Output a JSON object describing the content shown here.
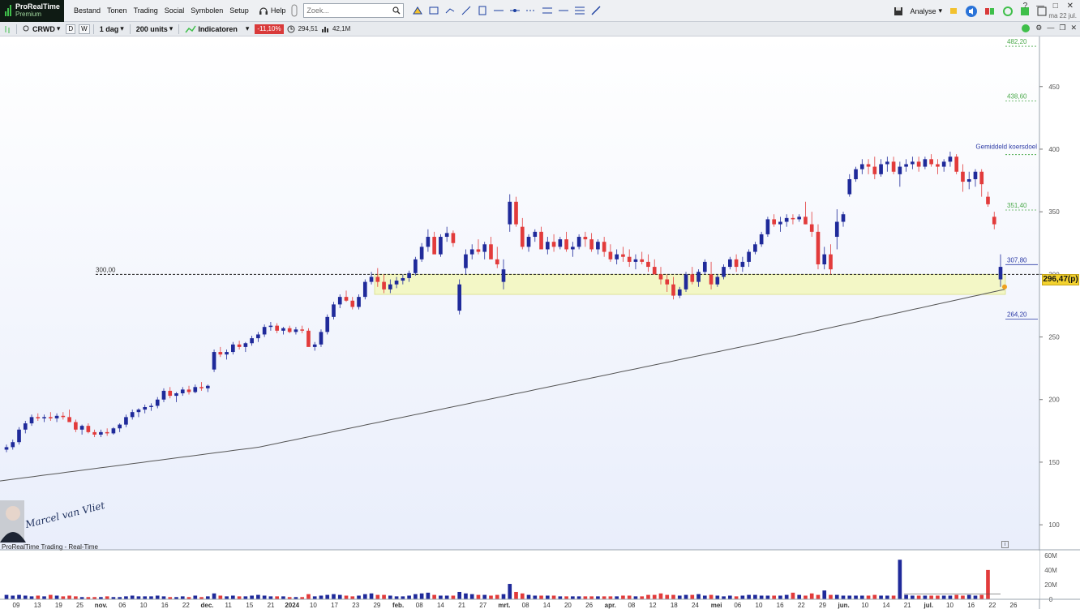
{
  "app": {
    "brand": "ProRealTime",
    "edition": "Premium",
    "date_short": "ma 22 jul."
  },
  "menu": [
    "Bestand",
    "Tonen",
    "Trading",
    "Social",
    "Symbolen",
    "Setup"
  ],
  "help_label": "Help",
  "search": {
    "placeholder": "Zoek..."
  },
  "analyse_label": "Analyse",
  "toolbar": {
    "symbol": "CRWD",
    "d_btn": "D",
    "w_btn": "W",
    "period": "1 dag",
    "units": "200 units",
    "indicators": "Indicatoren",
    "change": "-11,10%",
    "price": "294,51",
    "volume": "42,1M"
  },
  "caption": "ProRealTime Trading - Real-Time",
  "watermark_name": "Marcel van Vliet",
  "colors": {
    "up": "#1f2a9a",
    "down": "#e23b3b",
    "accent": "#f3d22e",
    "zone": "#f3f7c6",
    "ma": "#555555",
    "levels": "#4daa4d"
  },
  "chart_data": {
    "type": "candlestick",
    "symbol": "CRWD",
    "price_axis": {
      "ticks": [
        100,
        150,
        200,
        250,
        300,
        350,
        400,
        450
      ],
      "range": [
        80,
        490
      ]
    },
    "volume_axis": {
      "ticks": [
        "60M",
        "40M",
        "20M",
        "0"
      ],
      "range": [
        0,
        62
      ]
    },
    "x_labels": [
      "09",
      "13",
      "19",
      "25",
      "nov.",
      "06",
      "10",
      "16",
      "22",
      "dec.",
      "11",
      "15",
      "21",
      "2024",
      "10",
      "17",
      "23",
      "29",
      "feb.",
      "08",
      "14",
      "21",
      "27",
      "mrt.",
      "08",
      "14",
      "20",
      "26",
      "apr.",
      "08",
      "12",
      "18",
      "24",
      "mei",
      "06",
      "10",
      "16",
      "22",
      "29",
      "jun.",
      "10",
      "14",
      "21",
      "jul.",
      "10",
      "16",
      "22",
      "26"
    ],
    "current_price_label": "296,47(p)",
    "levels": [
      {
        "label": "482,20",
        "value": 482.2
      },
      {
        "label": "438,60",
        "value": 438.6
      },
      {
        "label": "Gemiddeld koersdoel",
        "value": 397
      },
      {
        "label": "351,40",
        "value": 351.4
      },
      {
        "label": "307,80",
        "value": 307.8
      },
      {
        "label": "300,00",
        "value": 300.0
      },
      {
        "label": "264,20",
        "value": 264.2
      }
    ],
    "support_zone": [
      284,
      300
    ],
    "moving_average": [
      [
        0,
        135
      ],
      [
        0.25,
        162
      ],
      [
        0.5,
        205
      ],
      [
        0.75,
        248
      ],
      [
        0.97,
        288
      ]
    ],
    "candles": [
      [
        160,
        164,
        158,
        162
      ],
      [
        162,
        168,
        160,
        166
      ],
      [
        166,
        178,
        164,
        176
      ],
      [
        176,
        183,
        173,
        181
      ],
      [
        181,
        188,
        179,
        186
      ],
      [
        186,
        189,
        183,
        185
      ],
      [
        185,
        188,
        182,
        186
      ],
      [
        186,
        190,
        183,
        185
      ],
      [
        185,
        189,
        182,
        187
      ],
      [
        187,
        190,
        184,
        186
      ],
      [
        186,
        192,
        183,
        182
      ],
      [
        182,
        184,
        174,
        176
      ],
      [
        176,
        180,
        172,
        179
      ],
      [
        179,
        181,
        173,
        174
      ],
      [
        174,
        176,
        170,
        172
      ],
      [
        172,
        176,
        170,
        174
      ],
      [
        174,
        177,
        171,
        173
      ],
      [
        173,
        178,
        172,
        177
      ],
      [
        177,
        181,
        174,
        180
      ],
      [
        180,
        188,
        178,
        186
      ],
      [
        186,
        192,
        184,
        190
      ],
      [
        190,
        193,
        186,
        192
      ],
      [
        192,
        196,
        189,
        194
      ],
      [
        194,
        197,
        191,
        195
      ],
      [
        195,
        202,
        193,
        200
      ],
      [
        200,
        209,
        198,
        207
      ],
      [
        207,
        210,
        201,
        203
      ],
      [
        203,
        206,
        198,
        205
      ],
      [
        205,
        210,
        203,
        208
      ],
      [
        208,
        211,
        204,
        206
      ],
      [
        206,
        212,
        205,
        210
      ],
      [
        210,
        214,
        207,
        209
      ],
      [
        209,
        212,
        206,
        211
      ],
      [
        224,
        240,
        222,
        238
      ],
      [
        238,
        242,
        234,
        236
      ],
      [
        236,
        240,
        232,
        238
      ],
      [
        238,
        246,
        236,
        244
      ],
      [
        244,
        247,
        240,
        242
      ],
      [
        242,
        246,
        238,
        245
      ],
      [
        245,
        251,
        243,
        249
      ],
      [
        249,
        254,
        246,
        252
      ],
      [
        252,
        260,
        250,
        258
      ],
      [
        258,
        262,
        255,
        259
      ],
      [
        259,
        261,
        253,
        255
      ],
      [
        255,
        258,
        252,
        257
      ],
      [
        257,
        259,
        253,
        254
      ],
      [
        254,
        258,
        252,
        256
      ],
      [
        256,
        259,
        253,
        255
      ],
      [
        255,
        257,
        248,
        242
      ],
      [
        242,
        246,
        239,
        244
      ],
      [
        244,
        256,
        242,
        254
      ],
      [
        254,
        268,
        252,
        266
      ],
      [
        266,
        278,
        264,
        276
      ],
      [
        276,
        284,
        273,
        282
      ],
      [
        282,
        287,
        278,
        279
      ],
      [
        279,
        282,
        272,
        274
      ],
      [
        274,
        284,
        272,
        282
      ],
      [
        282,
        296,
        280,
        294
      ],
      [
        294,
        302,
        292,
        298
      ],
      [
        298,
        305,
        290,
        294
      ],
      [
        294,
        300,
        285,
        288
      ],
      [
        288,
        296,
        285,
        292
      ],
      [
        292,
        298,
        289,
        295
      ],
      [
        295,
        300,
        292,
        297
      ],
      [
        297,
        303,
        294,
        301
      ],
      [
        301,
        314,
        299,
        312
      ],
      [
        312,
        325,
        310,
        322
      ],
      [
        322,
        336,
        318,
        330
      ],
      [
        330,
        334,
        318,
        316
      ],
      [
        316,
        332,
        314,
        330
      ],
      [
        330,
        338,
        326,
        333
      ],
      [
        333,
        335,
        322,
        325
      ],
      [
        271,
        296,
        268,
        292
      ],
      [
        305,
        320,
        300,
        316
      ],
      [
        316,
        324,
        312,
        320
      ],
      [
        320,
        328,
        316,
        318
      ],
      [
        318,
        326,
        312,
        324
      ],
      [
        324,
        330,
        318,
        312
      ],
      [
        312,
        322,
        305,
        308
      ],
      [
        294,
        312,
        288,
        304
      ],
      [
        340,
        364,
        334,
        358
      ],
      [
        358,
        362,
        338,
        340
      ],
      [
        338,
        345,
        320,
        322
      ],
      [
        322,
        332,
        318,
        330
      ],
      [
        330,
        336,
        326,
        334
      ],
      [
        334,
        338,
        322,
        320
      ],
      [
        320,
        330,
        316,
        326
      ],
      [
        326,
        332,
        318,
        322
      ],
      [
        322,
        330,
        320,
        328
      ],
      [
        328,
        334,
        318,
        320
      ],
      [
        320,
        326,
        314,
        322
      ],
      [
        322,
        332,
        320,
        330
      ],
      [
        330,
        334,
        322,
        328
      ],
      [
        328,
        333,
        318,
        320
      ],
      [
        320,
        328,
        316,
        326
      ],
      [
        326,
        330,
        314,
        318
      ],
      [
        318,
        324,
        310,
        312
      ],
      [
        312,
        320,
        308,
        316
      ],
      [
        316,
        322,
        310,
        314
      ],
      [
        314,
        320,
        306,
        310
      ],
      [
        310,
        316,
        304,
        312
      ],
      [
        312,
        318,
        308,
        310
      ],
      [
        310,
        316,
        302,
        306
      ],
      [
        306,
        312,
        300,
        300
      ],
      [
        300,
        306,
        292,
        296
      ],
      [
        296,
        300,
        286,
        292
      ],
      [
        292,
        298,
        280,
        283
      ],
      [
        283,
        290,
        281,
        288
      ],
      [
        288,
        302,
        286,
        300
      ],
      [
        300,
        306,
        292,
        294
      ],
      [
        294,
        304,
        290,
        302
      ],
      [
        302,
        312,
        300,
        310
      ],
      [
        300,
        310,
        288,
        292
      ],
      [
        292,
        300,
        290,
        298
      ],
      [
        298,
        308,
        296,
        306
      ],
      [
        306,
        314,
        304,
        312
      ],
      [
        312,
        316,
        302,
        306
      ],
      [
        306,
        314,
        302,
        310
      ],
      [
        310,
        320,
        306,
        318
      ],
      [
        318,
        326,
        316,
        324
      ],
      [
        324,
        334,
        322,
        332
      ],
      [
        332,
        346,
        330,
        344
      ],
      [
        344,
        348,
        338,
        340
      ],
      [
        340,
        346,
        334,
        342
      ],
      [
        342,
        348,
        338,
        345
      ],
      [
        345,
        348,
        340,
        344
      ],
      [
        344,
        348,
        342,
        346
      ],
      [
        346,
        358,
        340,
        340
      ],
      [
        340,
        350,
        330,
        334
      ],
      [
        334,
        340,
        304,
        308
      ],
      [
        308,
        322,
        304,
        316
      ],
      [
        316,
        324,
        300,
        304
      ],
      [
        330,
        352,
        320,
        342
      ],
      [
        342,
        350,
        338,
        348
      ],
      [
        364,
        380,
        362,
        376
      ],
      [
        376,
        386,
        374,
        384
      ],
      [
        384,
        392,
        380,
        388
      ],
      [
        388,
        392,
        380,
        386
      ],
      [
        386,
        394,
        376,
        380
      ],
      [
        380,
        392,
        378,
        388
      ],
      [
        388,
        394,
        382,
        390
      ],
      [
        390,
        394,
        380,
        382
      ],
      [
        380,
        390,
        370,
        386
      ],
      [
        386,
        392,
        382,
        388
      ],
      [
        388,
        394,
        384,
        390
      ],
      [
        390,
        394,
        382,
        386
      ],
      [
        386,
        394,
        384,
        392
      ],
      [
        392,
        396,
        386,
        388
      ],
      [
        388,
        392,
        380,
        386
      ],
      [
        386,
        392,
        382,
        390
      ],
      [
        390,
        398,
        386,
        394
      ],
      [
        394,
        396,
        380,
        382
      ],
      [
        382,
        388,
        366,
        374
      ],
      [
        374,
        382,
        368,
        376
      ],
      [
        376,
        384,
        370,
        382
      ],
      [
        382,
        384,
        362,
        372
      ],
      [
        362,
        366,
        354,
        356
      ],
      [
        346,
        350,
        336,
        340
      ],
      [
        296,
        316,
        290,
        306
      ]
    ],
    "volumes": [
      6,
      5,
      6,
      5,
      4,
      5,
      4,
      6,
      5,
      4,
      5,
      4,
      3,
      3,
      3,
      3,
      4,
      3,
      3,
      4,
      5,
      4,
      4,
      4,
      5,
      4,
      3,
      3,
      4,
      3,
      5,
      3,
      4,
      8,
      5,
      4,
      5,
      4,
      4,
      5,
      6,
      5,
      4,
      4,
      4,
      3,
      3,
      3,
      7,
      4,
      5,
      6,
      7,
      6,
      5,
      4,
      5,
      7,
      8,
      6,
      6,
      5,
      4,
      4,
      5,
      7,
      8,
      9,
      6,
      5,
      5,
      5,
      10,
      8,
      7,
      6,
      6,
      5,
      6,
      7,
      21,
      10,
      8,
      6,
      5,
      5,
      5,
      5,
      4,
      4,
      4,
      4,
      4,
      4,
      4,
      4,
      4,
      4,
      5,
      5,
      4,
      4,
      6,
      6,
      8,
      6,
      6,
      5,
      6,
      6,
      7,
      5,
      6,
      5,
      4,
      5,
      4,
      5,
      6,
      6,
      5,
      5,
      5,
      5,
      6,
      9,
      6,
      5,
      8,
      6,
      12,
      6,
      6,
      5,
      5,
      5,
      5,
      5,
      6,
      5,
      5,
      5,
      54,
      6,
      5,
      5,
      5,
      5,
      5,
      5,
      5,
      6,
      5,
      6,
      5,
      6,
      40
    ]
  }
}
